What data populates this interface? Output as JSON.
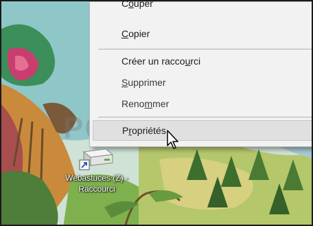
{
  "watermark": {
    "text": "PCASTUCES"
  },
  "context_menu": {
    "items": [
      {
        "prefix": "C",
        "accel": "o",
        "suffix": "uper",
        "state": "normal"
      },
      {
        "prefix": "",
        "accel": "C",
        "suffix": "opier",
        "state": "normal"
      },
      {
        "prefix": "Créer un racco",
        "accel": "u",
        "suffix": "rci",
        "state": "normal"
      },
      {
        "prefix": "",
        "accel": "S",
        "suffix": "upprimer",
        "state": "normal"
      },
      {
        "prefix": "Reno",
        "accel": "m",
        "suffix": "mer",
        "state": "normal"
      },
      {
        "prefix": "P",
        "accel": "r",
        "suffix": "opriétés",
        "state": "hover"
      }
    ]
  },
  "desktop_icon": {
    "label_line1": "Webastuces (Z) -",
    "label_line2": "Raccourci",
    "icon": "network-drive-shortcut-icon"
  },
  "cursor": {
    "icon": "arrow-cursor-icon"
  },
  "colors": {
    "menu_bg": "#f2f2f2",
    "menu_hover": "#e0e0e0",
    "text": "#1b1b1b"
  }
}
